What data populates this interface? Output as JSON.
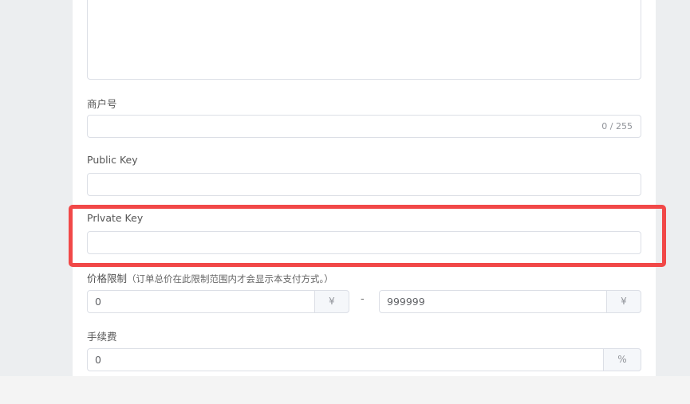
{
  "form": {
    "merchant_id": {
      "label": "商户号",
      "value": "",
      "counter": "0 / 255"
    },
    "public_key": {
      "label": "Public Key",
      "value": ""
    },
    "private_key": {
      "label": "Prlvate Key",
      "value": ""
    },
    "price_limit": {
      "label": "价格限制",
      "hint": "（订单总价在此限制范围内才会显示本支付方式。）",
      "min_value": "0",
      "max_value": "999999",
      "currency_symbol": "¥",
      "separator": "-"
    },
    "fee": {
      "label": "手续费",
      "value": "0",
      "unit": "%"
    }
  },
  "highlight_color": "#f14848"
}
